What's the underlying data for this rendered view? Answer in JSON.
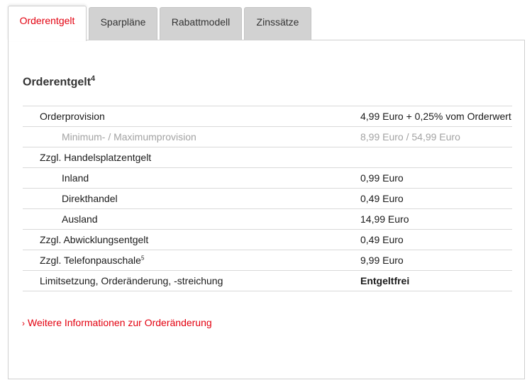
{
  "tabs": [
    {
      "label": "Orderentgelt",
      "active": true
    },
    {
      "label": "Sparpläne",
      "active": false
    },
    {
      "label": "Rabattmodell",
      "active": false
    },
    {
      "label": "Zinssätze",
      "active": false
    }
  ],
  "section": {
    "title": "Orderentgelt",
    "footnote": "4"
  },
  "rows": [
    {
      "label": "Orderprovision",
      "value": "4,99 Euro + 0,25% vom Orderwert"
    },
    {
      "label": "Minimum- / Maximumprovision",
      "value": "8,99 Euro / 54,99 Euro"
    },
    {
      "label": "Zzgl. Handelsplatzentgelt",
      "value": ""
    },
    {
      "label": "Inland",
      "value": "0,99 Euro"
    },
    {
      "label": "Direkthandel",
      "value": "0,49 Euro"
    },
    {
      "label": "Ausland",
      "value": "14,99 Euro"
    },
    {
      "label": "Zzgl. Abwicklungsentgelt",
      "value": "0,49 Euro"
    },
    {
      "label": "Zzgl. Telefonpauschale",
      "footnote": "5",
      "value": "9,99 Euro"
    },
    {
      "label": "Limitsetzung, Orderänderung, -streichung",
      "value": "Entgeltfrei"
    }
  ],
  "link": {
    "chevron": "›",
    "label": "Weitere Informationen zur Orderänderung"
  },
  "colors": {
    "accent": "#e3000f",
    "tab_inactive": "#d2d2d2",
    "muted_text": "#a3a3a3",
    "border": "#d9d9d9"
  }
}
